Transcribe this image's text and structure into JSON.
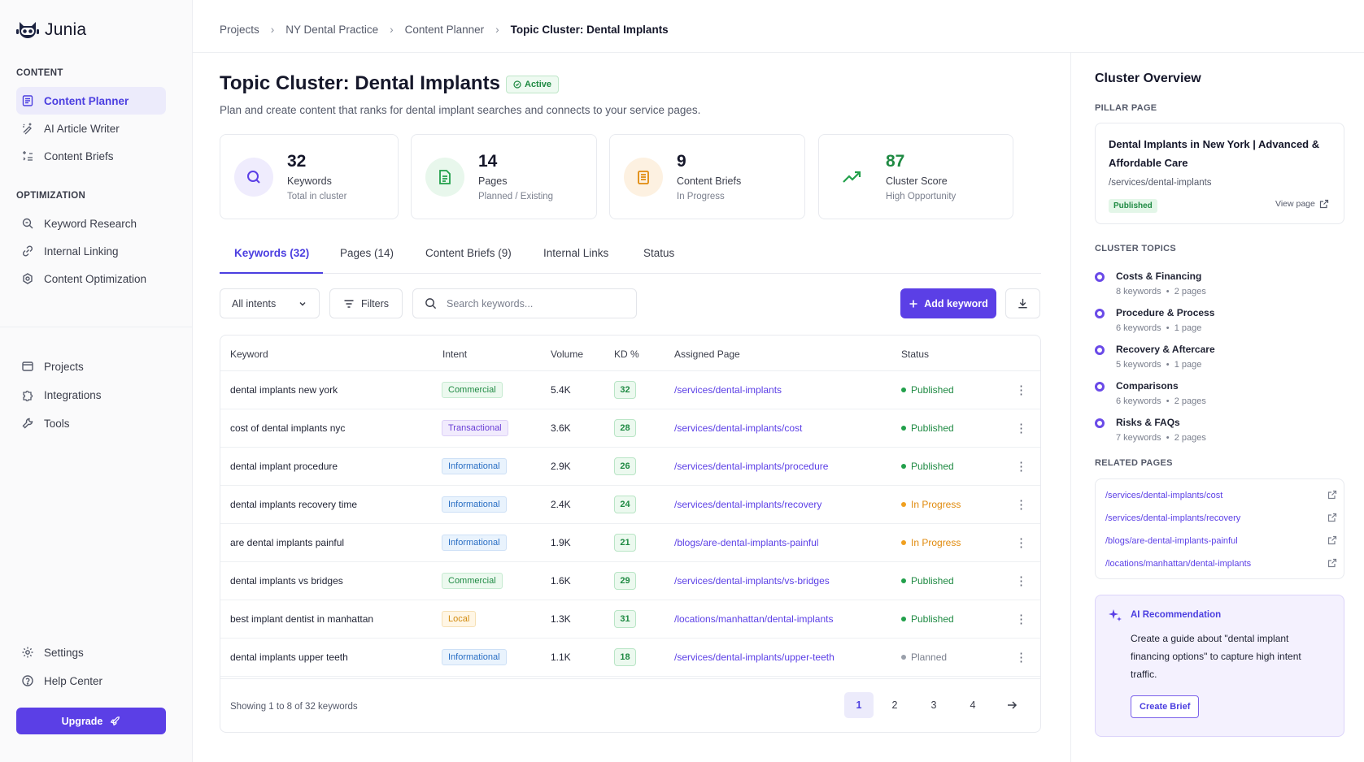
{
  "app": {
    "name": "Junia"
  },
  "sidebar": {
    "content_label": "CONTENT",
    "optimization_label": "OPTIMIZATION",
    "items": [
      {
        "label": "Content Planner",
        "icon": "document-list-icon"
      },
      {
        "label": "AI Article Writer",
        "icon": "sparkle-pen-icon"
      },
      {
        "label": "Content Briefs",
        "icon": "sparkle-list-icon"
      },
      {
        "label": "Keyword Research",
        "icon": "magnifier-icon"
      },
      {
        "label": "Internal Linking",
        "icon": "link-icon"
      },
      {
        "label": "Content Optimization",
        "icon": "gauge-icon"
      },
      {
        "label": "Projects",
        "icon": "folder-icon"
      },
      {
        "label": "Integrations",
        "icon": "puzzle-icon"
      },
      {
        "label": "Tools",
        "icon": "wrench-icon"
      },
      {
        "label": "Settings",
        "icon": "gear-icon"
      },
      {
        "label": "Help Center",
        "icon": "help-circle-icon"
      }
    ],
    "upgrade_label": "Upgrade"
  },
  "breadcrumb": [
    "Projects",
    "NY Dental Practice",
    "Content Planner",
    "Topic Cluster: Dental Implants"
  ],
  "header": {
    "title": "Topic Cluster: Dental Implants",
    "status": "Active",
    "subtitle": "Plan and create content that ranks for dental implant searches and connects to your service pages."
  },
  "stats": [
    {
      "value": "32",
      "label": "Keywords",
      "sub": "Total in cluster"
    },
    {
      "value": "14",
      "label": "Pages",
      "sub": "Planned / Existing"
    },
    {
      "value": "9",
      "label": "Content Briefs",
      "sub": "In Progress"
    },
    {
      "value": "87",
      "label": "Cluster Score",
      "sub": "High Opportunity"
    }
  ],
  "tabs": [
    "Keywords (32)",
    "Pages (14)",
    "Content Briefs (9)",
    "Internal Links",
    "Status"
  ],
  "toolbar": {
    "intent_select": "All intents",
    "filters_label": "Filters",
    "search_placeholder": "Search keywords...",
    "add_label": "Add keyword"
  },
  "table": {
    "columns": [
      "Keyword",
      "Intent",
      "Volume",
      "KD %",
      "Assigned Page",
      "Status"
    ],
    "rows": [
      [
        "dental implants new york",
        "Commercial",
        "5.4K",
        "32",
        "/services/dental-implants",
        "Published"
      ],
      [
        "cost of dental implants nyc",
        "Transactional",
        "3.6K",
        "28",
        "/services/dental-implants/cost",
        "Published"
      ],
      [
        "dental implant procedure",
        "Informational",
        "2.9K",
        "26",
        "/services/dental-implants/procedure",
        "Published"
      ],
      [
        "dental implants recovery time",
        "Informational",
        "2.4K",
        "24",
        "/services/dental-implants/recovery",
        "In Progress"
      ],
      [
        "are dental implants painful",
        "Informational",
        "1.9K",
        "21",
        "/blogs/are-dental-implants-painful",
        "In Progress"
      ],
      [
        "dental implants vs bridges",
        "Commercial",
        "1.6K",
        "29",
        "/services/dental-implants/vs-bridges",
        "Published"
      ],
      [
        "best implant dentist in manhattan",
        "Local",
        "1.3K",
        "31",
        "/locations/manhattan/dental-implants",
        "Published"
      ],
      [
        "dental implants upper teeth",
        "Informational",
        "1.1K",
        "18",
        "/services/dental-implants/upper-teeth",
        "Planned"
      ]
    ],
    "showing": "Showing 1 to 8 of 32 keywords",
    "pages": [
      "1",
      "2",
      "3",
      "4"
    ]
  },
  "overview": {
    "title": "Cluster Overview",
    "pillar_label": "PILLAR PAGE",
    "pillar_title": "Dental Implants in New York | Advanced & Affordable Care",
    "pillar_url": "/services/dental-implants",
    "pillar_status": "Published",
    "view_page": "View page",
    "topics_label": "CLUSTER TOPICS",
    "topics": [
      {
        "name": "Costs & Financing",
        "keywords": "8 keywords",
        "pages": "2 pages"
      },
      {
        "name": "Procedure & Process",
        "keywords": "6 keywords",
        "pages": "1 page"
      },
      {
        "name": "Recovery & Aftercare",
        "keywords": "5 keywords",
        "pages": "1 page"
      },
      {
        "name": "Comparisons",
        "keywords": "6 keywords",
        "pages": "2 pages"
      },
      {
        "name": "Risks & FAQs",
        "keywords": "7 keywords",
        "pages": "2 pages"
      }
    ],
    "related_label": "RELATED PAGES",
    "related": [
      "/services/dental-implants/cost",
      "/services/dental-implants/recovery",
      "/blogs/are-dental-implants-painful",
      "/locations/manhattan/dental-implants"
    ],
    "ai_title": "AI Recommendation",
    "ai_body": "Create a guide about \"dental implant financing options\" to capture high intent traffic.",
    "ai_button": "Create Brief"
  },
  "colors": {
    "accent": "#5b3fe6",
    "published": "#1f8a43",
    "in_progress": "#e08a0c",
    "planned": "#7a7f8d"
  }
}
